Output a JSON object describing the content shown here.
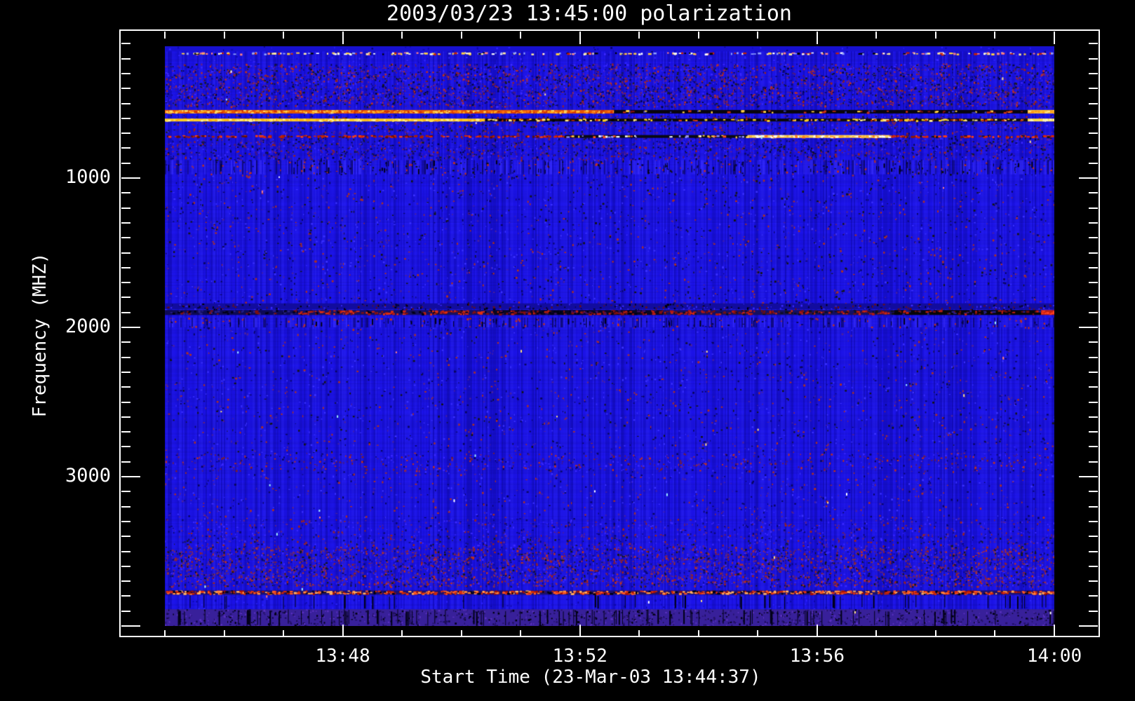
{
  "chart": {
    "title": "2003/03/23 13:45:00 polarization",
    "x_axis": {
      "label": "Start Time (23-Mar-03 13:44:37)",
      "major_tick_labels": [
        "13:48",
        "13:52",
        "13:56",
        "14:00"
      ],
      "major_tick_minutes": [
        3,
        7,
        11,
        15
      ],
      "minor_tick_interval": "1 min",
      "data_start": "13:45:00",
      "data_end": "14:00:00"
    },
    "y_axis": {
      "label": "Frequency (MHZ)",
      "major_tick_labels": [
        "1000",
        "2000",
        "3000"
      ],
      "major_tick_values": [
        1000,
        2000,
        3000
      ],
      "minor_step_mhz": 100,
      "range_mhz": [
        100,
        4000
      ],
      "direction": "increasing downward"
    }
  },
  "chart_data": {
    "type": "heatmap",
    "title": "2003/03/23 13:45:00 polarization",
    "xlabel": "Start Time (23-Mar-03 13:44:37)",
    "ylabel": "Frequency (MHZ)",
    "x_range": [
      "13:44:37",
      "14:00:00"
    ],
    "ylim_mhz": [
      100,
      4000
    ],
    "base_color": "#1c13ea",
    "background_color": "#000000",
    "features": [
      {
        "freq_mhz": 157,
        "description": "dotted speckle line, white/yellow/red dots on dark blue"
      },
      {
        "freq_mhz": 545,
        "description": "bright orange interference line 13:45-13:52, dark with red specks 13:52-13:59, yellow at right edge"
      },
      {
        "freq_mhz": 605,
        "description": "bright yellow interference line with black dropouts after 13:50"
      },
      {
        "freq_mhz": 712,
        "description": "red dotted line; bright white-yellow segment ~13:54-13:57"
      },
      {
        "freq_mhz": 1887,
        "description": "dark horizontal band with red interference, black segment near 13:59"
      },
      {
        "freq_range_mhz": [
          3470,
          3735
        ],
        "description": "dense mottled purple-red noise band"
      },
      {
        "freq_mhz": 3764,
        "description": "dense red-orange interference band across full width"
      },
      {
        "freq_range_mhz": [
          3890,
          4000
        ],
        "description": "purple band with black vertical dropouts at bottom of data"
      }
    ],
    "bands": [
      {
        "f0": 100,
        "f1": 152,
        "base": "#1710cf",
        "speckle": 0.05,
        "colors": [
          "#0d08a8",
          "#2c22ff",
          "#050560"
        ]
      },
      {
        "f0": 163,
        "f1": 232,
        "speckle": 0.04,
        "colors": [
          "#0d08a8",
          "#2c22ff",
          "#3a28ff"
        ]
      },
      {
        "f0": 232,
        "f1": 520,
        "speckle": 0.55,
        "colors": [
          "#4a1880",
          "#a02418",
          "#0c0870",
          "#050540",
          "#3a28ff",
          "#1c1c1c",
          "#602090",
          "#c03020"
        ]
      },
      {
        "f0": 575,
        "f1": 600,
        "speckle": 0.35,
        "colors": [
          "#4a1880",
          "#a02418",
          "#0c0870",
          "#3a28ff",
          "#1c1c1c"
        ]
      },
      {
        "f0": 622,
        "f1": 700,
        "speckle": 0.35,
        "colors": [
          "#4a1880",
          "#a02418",
          "#0c0870",
          "#3a28ff",
          "#1c1c1c",
          "#602090"
        ]
      },
      {
        "f0": 728,
        "f1": 880,
        "speckle": 0.4,
        "colors": [
          "#4a1880",
          "#a02418",
          "#0c0870",
          "#050540",
          "#3a28ff",
          "#1c1c1c",
          "#602090"
        ]
      },
      {
        "f0": 880,
        "f1": 975,
        "stripes": 0.55,
        "stripe_colors": [
          "#3a30ff",
          "#2a20f0",
          "#0a0550"
        ],
        "speckle": 0.12,
        "colors": [
          "#c03020",
          "#0a0550",
          "#101010"
        ],
        "vticks": 0.5
      },
      {
        "f0": 975,
        "f1": 1840,
        "speckle": 0.1,
        "colors": [
          "#4a20a0",
          "#b03020",
          "#0a0660",
          "#3a30ff",
          "#151515"
        ]
      },
      {
        "f0": 1840,
        "f1": 1878,
        "base": "#120c9e",
        "speckle": 0.3,
        "colors": [
          "#050530",
          "#701010",
          "#000000",
          "#3a28ff"
        ]
      },
      {
        "f0": 1935,
        "f1": 2000,
        "stripes": 0.5,
        "stripe_colors": [
          "#3a30ff",
          "#2a20f0",
          "#0a0550"
        ],
        "speckle": 0.1,
        "colors": [
          "#c03020",
          "#0a0550"
        ],
        "vticks": 0.3
      },
      {
        "f0": 2000,
        "f1": 2840,
        "speckle": 0.08,
        "colors": [
          "#4a20a0",
          "#b03020",
          "#0a0660",
          "#3a30ff",
          "#151515"
        ]
      },
      {
        "f0": 2840,
        "f1": 2960,
        "speckle": 0.22,
        "colors": [
          "#802028",
          "#4a1880",
          "#0a0660",
          "#c03020",
          "#3a28ff"
        ]
      },
      {
        "f0": 2960,
        "f1": 3280,
        "speckle": 0.08,
        "colors": [
          "#4a20a0",
          "#b03020",
          "#0a0660",
          "#3a30ff"
        ]
      },
      {
        "f0": 3280,
        "f1": 3395,
        "speckle": 0.2,
        "colors": [
          "#5a2090",
          "#a02418",
          "#0c0870",
          "#3a28ff"
        ]
      },
      {
        "f0": 3395,
        "f1": 3470,
        "speckle": 0.25,
        "colors": [
          "#5a2090",
          "#a02418",
          "#0c0870",
          "#3a28ff",
          "#1c1c1c"
        ]
      },
      {
        "f0": 3470,
        "f1": 3735,
        "speckle": 0.55,
        "colors": [
          "#50208a",
          "#a02418",
          "#0c0870",
          "#3a28ff",
          "#181818",
          "#803050",
          "#c03020"
        ]
      },
      {
        "f0": 3788,
        "f1": 3888,
        "speckle": 0.05,
        "colors": [
          "#0d08a8",
          "#2c22ff"
        ],
        "vticks": 0.35,
        "tick_tall": true
      },
      {
        "f0": 3888,
        "f1": 4000,
        "base": "#38209a",
        "speckle": 0.35,
        "colors": [
          "#241266",
          "#160a50",
          "#000010",
          "#5a30c0"
        ],
        "vticks": 0.8,
        "tick_tall": true
      }
    ],
    "lines": [
      {
        "name": "speckle-dotted-line",
        "f": 157,
        "h": 4,
        "segments": [
          {
            "t0": 0,
            "t1": 1,
            "cov": 0.32,
            "colors": [
              "#ffffff",
              "#ffd040",
              "#cc2200",
              "#000000",
              "#90a0ff",
              "#ff8080",
              "#ffe9a0"
            ]
          }
        ]
      },
      {
        "name": "bright-line-545",
        "f": 544,
        "h": 5,
        "segments": [
          {
            "t0": 0,
            "t1": 0.505,
            "bg": "#e85800",
            "cov": 0.8,
            "colors": [
              "#ffb020",
              "#ff7010",
              "#ffd860",
              "#d03000"
            ]
          },
          {
            "t0": 0.505,
            "t1": 0.97,
            "bg": "#08040c",
            "cov": 0.14,
            "colors": [
              "#d03010",
              "#ffd040",
              "#3333bb",
              "#801010"
            ]
          },
          {
            "t0": 0.97,
            "t1": 1,
            "bg": "#ffc030",
            "cov": 0.5,
            "colors": [
              "#ff9818",
              "#ffe080"
            ]
          }
        ]
      },
      {
        "name": "bright-line-605",
        "f": 602,
        "h": 4,
        "segments": [
          {
            "t0": 0,
            "t1": 0.36,
            "bg": "#ffd020",
            "cov": 0.6,
            "colors": [
              "#ffe14a",
              "#fff2a0",
              "#ffb010"
            ]
          },
          {
            "t0": 0.36,
            "t1": 0.55,
            "bg": "#100a06",
            "cov": 0.5,
            "colors": [
              "#ffd020",
              "#c03000",
              "#ffe880",
              "#000000"
            ]
          },
          {
            "t0": 0.55,
            "t1": 0.76,
            "bg": "#0a0808",
            "cov": 0.22,
            "colors": [
              "#ffd020",
              "#d04010",
              "#3333bb"
            ]
          },
          {
            "t0": 0.76,
            "t1": 0.97,
            "bg": "#120d08",
            "cov": 0.5,
            "colors": [
              "#ffd020",
              "#c03000",
              "#ffee90"
            ]
          },
          {
            "t0": 0.97,
            "t1": 1,
            "bg": "#ffe14a",
            "cov": 0.4,
            "colors": [
              "#fff6c0"
            ]
          }
        ]
      },
      {
        "name": "red-line-712",
        "f": 712,
        "h": 4,
        "segments": [
          {
            "t0": 0,
            "t1": 0.45,
            "cov": 0.55,
            "colors": [
              "#e02800",
              "#b02000",
              "#ff4010",
              "#601000"
            ]
          },
          {
            "t0": 0.45,
            "t1": 0.655,
            "bg": "#090910",
            "cov": 0.25,
            "colors": [
              "#ffffff",
              "#ff5020",
              "#ffd040",
              "#9090ff"
            ]
          },
          {
            "t0": 0.655,
            "t1": 0.815,
            "bg": "#ffd860",
            "cov": 0.7,
            "colors": [
              "#fff6c0",
              "#ffffff",
              "#ffb030",
              "#ff8020"
            ]
          },
          {
            "t0": 0.815,
            "t1": 1,
            "cov": 0.6,
            "colors": [
              "#e02800",
              "#901800",
              "#ff4010",
              "#151515"
            ]
          }
        ]
      },
      {
        "name": "dark-line-1887",
        "f": 1884,
        "h": 7,
        "segments": [
          {
            "t0": 0,
            "t1": 0.15,
            "bg": "#0d0a55",
            "cov": 0.4,
            "colors": [
              "#000014",
              "#28208a",
              "#801010"
            ]
          },
          {
            "t0": 0.15,
            "t1": 0.37,
            "bg": "#151060",
            "cov": 0.55,
            "colors": [
              "#c02010",
              "#801010",
              "#000014",
              "#e03010"
            ]
          },
          {
            "t0": 0.37,
            "t1": 0.56,
            "bg": "#0a0720",
            "cov": 0.6,
            "colors": [
              "#801010",
              "#c02010",
              "#000014",
              "#401060"
            ]
          },
          {
            "t0": 0.56,
            "t1": 0.82,
            "bg": "#151060",
            "cov": 0.5,
            "colors": [
              "#b01810",
              "#701010",
              "#101018",
              "#d02810"
            ]
          },
          {
            "t0": 0.82,
            "t1": 0.985,
            "bg": "#060608",
            "cov": 0.3,
            "colors": [
              "#701010",
              "#c02010",
              "#28208a"
            ]
          },
          {
            "t0": 0.985,
            "t1": 1,
            "bg": "#c02010",
            "cov": 0.4,
            "colors": [
              "#ff4020"
            ]
          }
        ]
      },
      {
        "name": "red-band-3764",
        "f": 3762,
        "h": 6,
        "segments": [
          {
            "t0": 0,
            "t1": 1,
            "bg": "#1a1070",
            "cov": 0.8,
            "colors": [
              "#e03010",
              "#ff5820",
              "#a81000",
              "#000010",
              "#ff9040",
              "#d02800",
              "#ffb060"
            ]
          }
        ]
      }
    ],
    "sparkles": {
      "count": 42,
      "colors": [
        "#ffffff",
        "#a0f0ff",
        "#ffe080",
        "#ff8080"
      ]
    }
  }
}
